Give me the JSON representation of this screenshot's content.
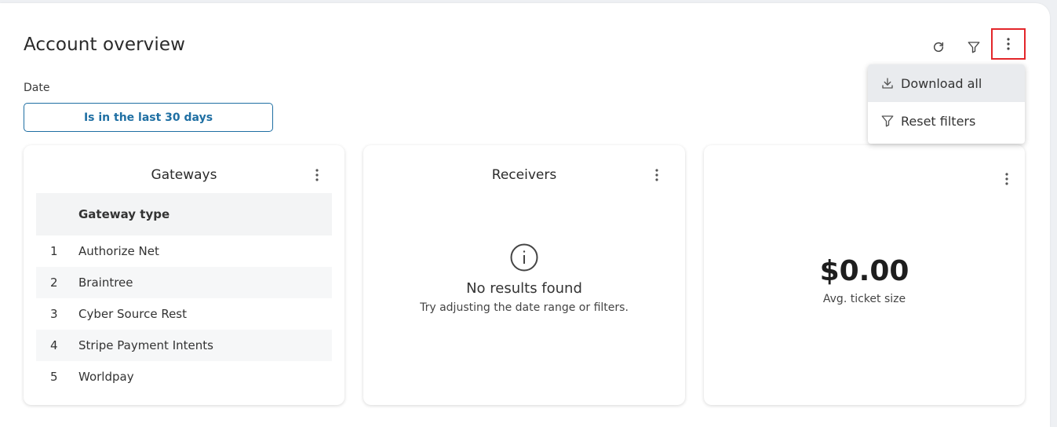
{
  "header": {
    "title": "Account overview",
    "refresh_icon": "refresh-icon",
    "filter_icon": "filter-icon",
    "menu_icon": "more-vertical-icon"
  },
  "filters": {
    "date_label": "Date",
    "date_value": "Is in the last 30 days"
  },
  "dropdown": {
    "items": [
      {
        "label": "Download all",
        "icon": "download-icon"
      },
      {
        "label": "Reset filters",
        "icon": "filter-icon"
      }
    ]
  },
  "gateways": {
    "title": "Gateways",
    "column_header": "Gateway type",
    "rows": [
      {
        "num": "1",
        "value": "Authorize Net"
      },
      {
        "num": "2",
        "value": "Braintree"
      },
      {
        "num": "3",
        "value": "Cyber Source Rest"
      },
      {
        "num": "4",
        "value": "Stripe Payment Intents"
      },
      {
        "num": "5",
        "value": "Worldpay"
      }
    ]
  },
  "receivers": {
    "title": "Receivers",
    "empty_title": "No results found",
    "empty_sub": "Try adjusting the date range or filters."
  },
  "ticket": {
    "value": "$0.00",
    "label": "Avg. ticket size"
  },
  "colors": {
    "accent": "#1f6fa3",
    "highlight_border": "#e3262a"
  }
}
